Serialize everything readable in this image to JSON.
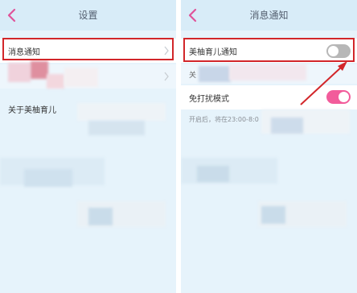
{
  "left": {
    "title": "设置",
    "rows": [
      "消息通知",
      "关于美柚育儿"
    ]
  },
  "right": {
    "title": "消息通知",
    "rows": [
      "美柚育儿通知",
      "免打扰模式"
    ],
    "hint": "开启后，将在23:00-8:0",
    "fragment": "关"
  },
  "colors": {
    "highlight": "#d2262a",
    "toggle_on": "#f25c9b",
    "toggle_off": "#b7b7b7",
    "back_icon": "#e0549a"
  },
  "icons": [
    "back-arrow-icon",
    "chevron-right-icon"
  ]
}
